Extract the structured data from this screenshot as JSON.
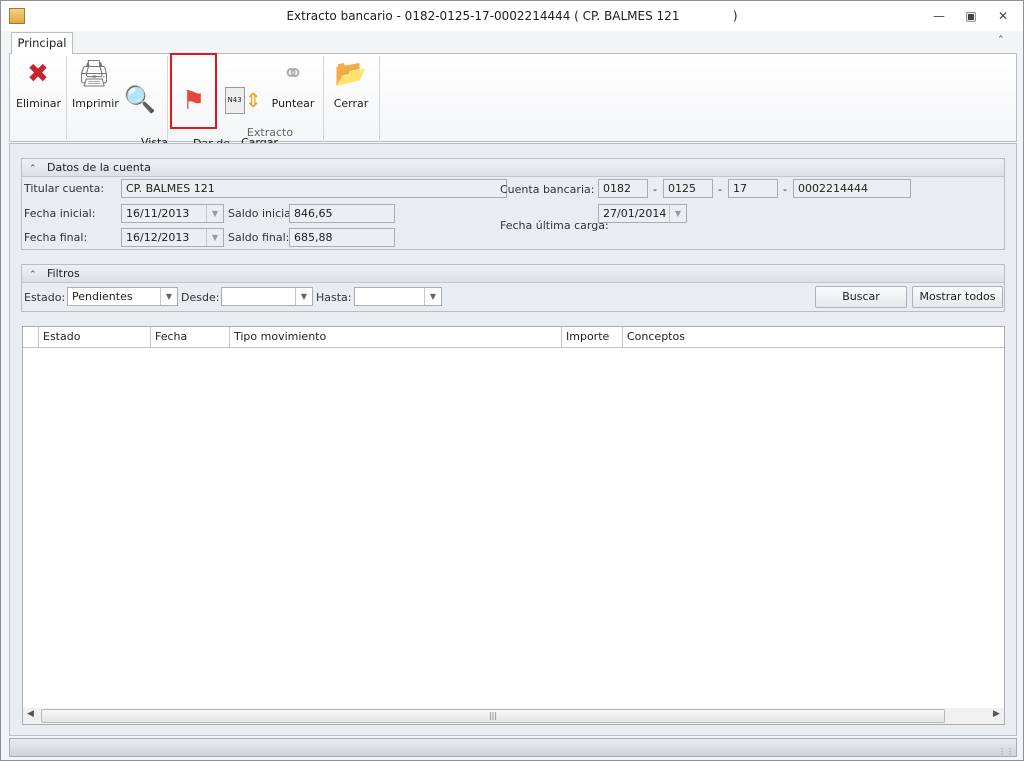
{
  "window": {
    "title": "Extracto bancario - 0182-0125-17-0002214444 ( CP. BALMES 121              )",
    "app_icon": "43"
  },
  "ribbon": {
    "tab": "Principal",
    "buttons": {
      "eliminar": "Eliminar",
      "imprimir": "Imprimir",
      "vista_previa": "Vista\nprevia",
      "dar_de_baja": "Dar de\nbaja",
      "cargar_extracto": "Cargar\nextracto",
      "puntear": "Puntear",
      "cerrar": "Cerrar"
    },
    "group_extracto": "Extracto",
    "n43": "N43"
  },
  "datos": {
    "title": "Datos de la cuenta",
    "titular_label": "Titular cuenta:",
    "titular": "CP. BALMES 121",
    "fecha_inicial_label": "Fecha inicial:",
    "fecha_inicial": "16/11/2013",
    "fecha_final_label": "Fecha final:",
    "fecha_final": "16/12/2013",
    "saldo_inicial_label": "Saldo inicial:",
    "saldo_inicial": "846,65",
    "saldo_final_label": "Saldo final:",
    "saldo_final": "685,88",
    "cuenta_label": "Cuenta bancaria:",
    "cuenta": [
      "0182",
      "0125",
      "17",
      "0002214444"
    ],
    "sep": "-",
    "ultima_carga_label": "Fecha última carga:",
    "ultima_carga": "27/01/2014"
  },
  "filtros": {
    "title": "Filtros",
    "estado_label": "Estado:",
    "estado": "Pendientes",
    "desde_label": "Desde:",
    "desde": "",
    "hasta_label": "Hasta:",
    "hasta": "",
    "buscar": "Buscar",
    "mostrar_todos": "Mostrar todos"
  },
  "grid": {
    "columns": [
      "Estado",
      "Fecha",
      "Tipo movimiento",
      "Importe",
      "Conceptos"
    ],
    "rows": []
  },
  "colors": {
    "highlight": "#e8141b",
    "flag": "#e8463c"
  }
}
